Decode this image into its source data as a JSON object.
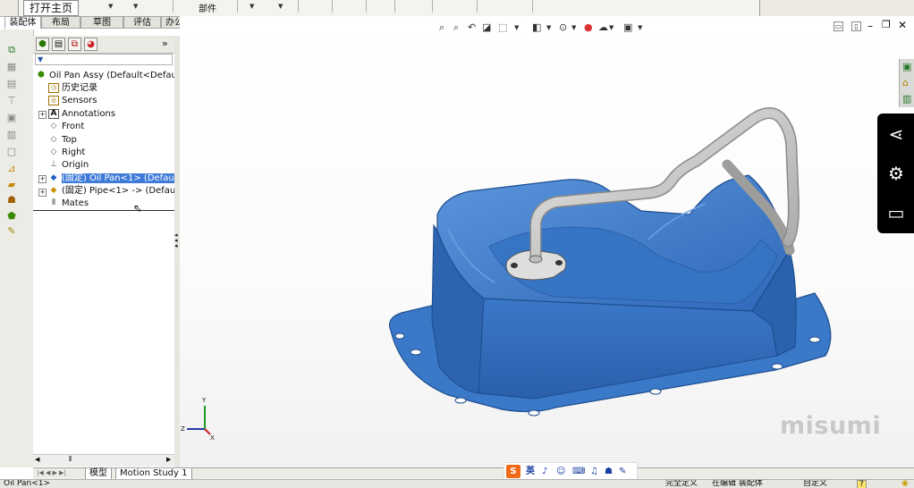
{
  "ribbon": {
    "home_button": "打开主页",
    "assembly_group": "部件",
    "tabs": [
      "装配体",
      "布局",
      "草图",
      "评估",
      "办公室产品"
    ]
  },
  "feature_tree": {
    "filter_icon": "funnel-icon",
    "items": [
      {
        "label": "Oil Pan Assy  (Default<Default",
        "icon": "assembly-icon"
      },
      {
        "label": "历史记录",
        "icon": "history-icon"
      },
      {
        "label": "Sensors",
        "icon": "sensor-icon"
      },
      {
        "label": "Annotations",
        "icon": "annotation-icon"
      },
      {
        "label": "Front",
        "icon": "plane-icon"
      },
      {
        "label": "Top",
        "icon": "plane-icon"
      },
      {
        "label": "Right",
        "icon": "plane-icon"
      },
      {
        "label": "Origin",
        "icon": "origin-icon"
      },
      {
        "label": "(固定) Oil Pan<1> (Default",
        "icon": "part-icon",
        "selected": true
      },
      {
        "label": "(固定) Pipe<1> -> (Default",
        "icon": "part-icon"
      },
      {
        "label": "Mates",
        "icon": "mates-icon"
      }
    ]
  },
  "bottom_tabs": [
    "模型",
    "Motion Study 1"
  ],
  "ime": {
    "lang": "英"
  },
  "axes": {
    "x": "X",
    "y": "Y",
    "z": "Z"
  },
  "share_bar": [
    "share-icon",
    "settings-icon",
    "monitor-icon"
  ],
  "watermark": "misumi",
  "status": {
    "left": "Oil Pan<1>",
    "defined": "完全定义",
    "editing": "在编辑 装配体",
    "custom": "自定义",
    "help": "?"
  },
  "colors": {
    "part_blue": "#3a78c8",
    "pipe_gray": "#c6c6c4",
    "selection": "#3f7bd9"
  }
}
